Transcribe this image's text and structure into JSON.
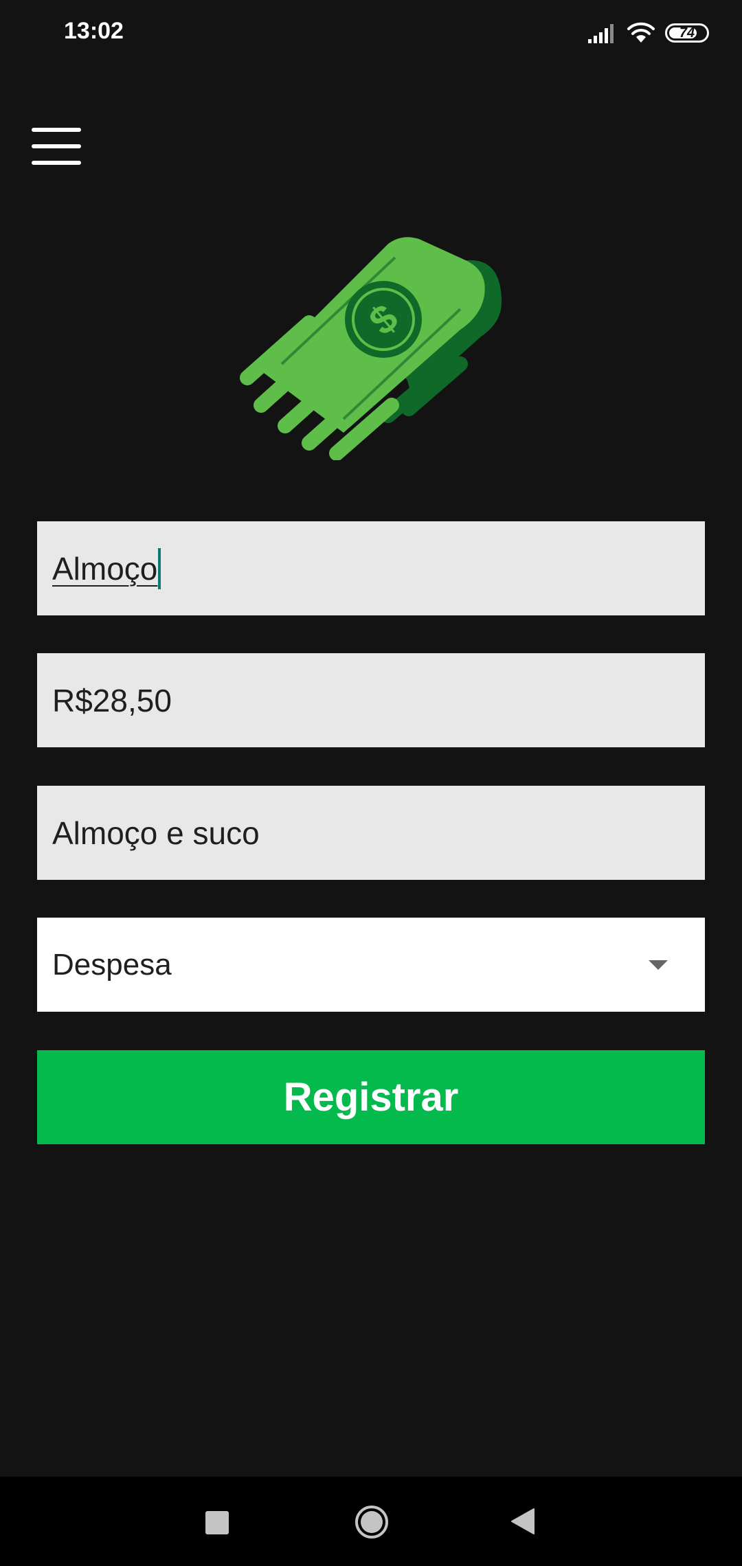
{
  "status_bar": {
    "time": "13:02",
    "battery": "74",
    "icons": [
      "signal-icon",
      "wifi-icon",
      "battery-icon"
    ]
  },
  "menu": {
    "icon": "hamburger-menu-icon"
  },
  "logo": {
    "icon": "flying-money-icon"
  },
  "form": {
    "name": {
      "value": "Almoço"
    },
    "amount": {
      "value": "R$28,50"
    },
    "description": {
      "value": "Almoço e suco"
    },
    "type": {
      "selected": "Despesa"
    },
    "submit_label": "Registrar"
  },
  "nav": {
    "icons": [
      "recents-square-icon",
      "home-circle-icon",
      "back-triangle-icon"
    ]
  },
  "colors": {
    "background": "#131313",
    "accent": "#05ba4c",
    "field_bg": "#e8e8e8",
    "cursor": "#0a7a6e"
  }
}
